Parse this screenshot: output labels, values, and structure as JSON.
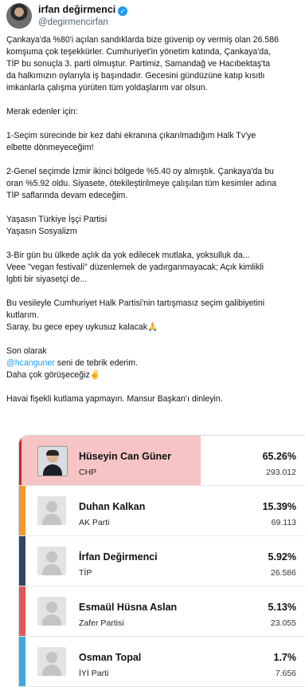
{
  "author": {
    "name": "irfan değirmenci",
    "handle": "@degirmencirfan",
    "verified_mark": "✓"
  },
  "tweet": {
    "paragraphs": [
      [
        "Çankaya'da %80'i açılan sandıklarda bize güvenip oy vermiş olan 26.586",
        "komşuma çok teşekkürler. Cumhuriyet'in yönetim katında, Çankaya'da,",
        "TİP bu sonuçla 3. parti olmuştur. Partimiz, Samandağ ve Hacıbektaş'ta",
        "da halkımızın oylarıyla iş başındadır. Gecesini gündüzüne katıp kısıtlı",
        "imkanlarla çalışma yürüten tüm yoldaşlarım var olsun."
      ],
      [
        "Merak edenler için:"
      ],
      [
        "1-Seçim sürecinde bir kez dahi ekranına çıkarılmadığım Halk Tv'ye",
        "elbette dönmeyeceğim!"
      ],
      [
        "2-Genel seçimde İzmir ikinci bölgede %5.40 oy almıştık. Çankaya'da bu",
        "oran %5.92 oldu. Siyasete, ötekileştirilmeye çalışılan tüm kesimler adına",
        "TİP saflarında devam edeceğim."
      ],
      [
        "Yaşasın Türkiye İşçi Partisi",
        "Yaşasın Sosyalizm"
      ],
      [
        "3-Bir gün bu ülkede açlık da yok edilecek mutlaka, yoksulluk da...",
        "Veee \"vegan festivali\" düzenlemek de yadırganmayacak; Açık kimlikli",
        "lgbti bir siyasetçi de..."
      ],
      [
        "Bu vesileyle Cumhuriyet Halk Partisi'nin tartışmasız seçim galibiyetini",
        "kutlarım.",
        "Saray, bu gece epey uykusuz kalacak🙏"
      ],
      [
        "Son olarak",
        "@hcanguner seni de tebrik ederim.",
        "Daha çok görüşeceğiz✌️"
      ],
      [
        "Havai fişekli kutlama yapmayın. Mansur Başkan'ı dinleyin."
      ]
    ],
    "mention": "@hcanguner"
  },
  "results": {
    "candidates": [
      {
        "name": "Hüseyin Can Güner",
        "party": "CHP",
        "percent": "65.26%",
        "votes": "293.012",
        "color": "#d81e24",
        "highlight": "#f6c4c4",
        "has_photo": true
      },
      {
        "name": "Duhan Kalkan",
        "party": "AK Parti",
        "percent": "15.39%",
        "votes": "69.113",
        "color": "#f29a2e",
        "highlight": "",
        "has_photo": false
      },
      {
        "name": "İrfan Değirmenci",
        "party": "TİP",
        "percent": "5.92%",
        "votes": "26.586",
        "color": "#334466",
        "highlight": "",
        "has_photo": false
      },
      {
        "name": "Esmaül Hüsna Aslan",
        "party": "Zafer Partisi",
        "percent": "5.13%",
        "votes": "23.055",
        "color": "#e05a5a",
        "highlight": "",
        "has_photo": false
      },
      {
        "name": "Osman Topal",
        "party": "İYİ Parti",
        "percent": "1.7%",
        "votes": "7.656",
        "color": "#3aa9e0",
        "highlight": "",
        "has_photo": false
      }
    ]
  }
}
